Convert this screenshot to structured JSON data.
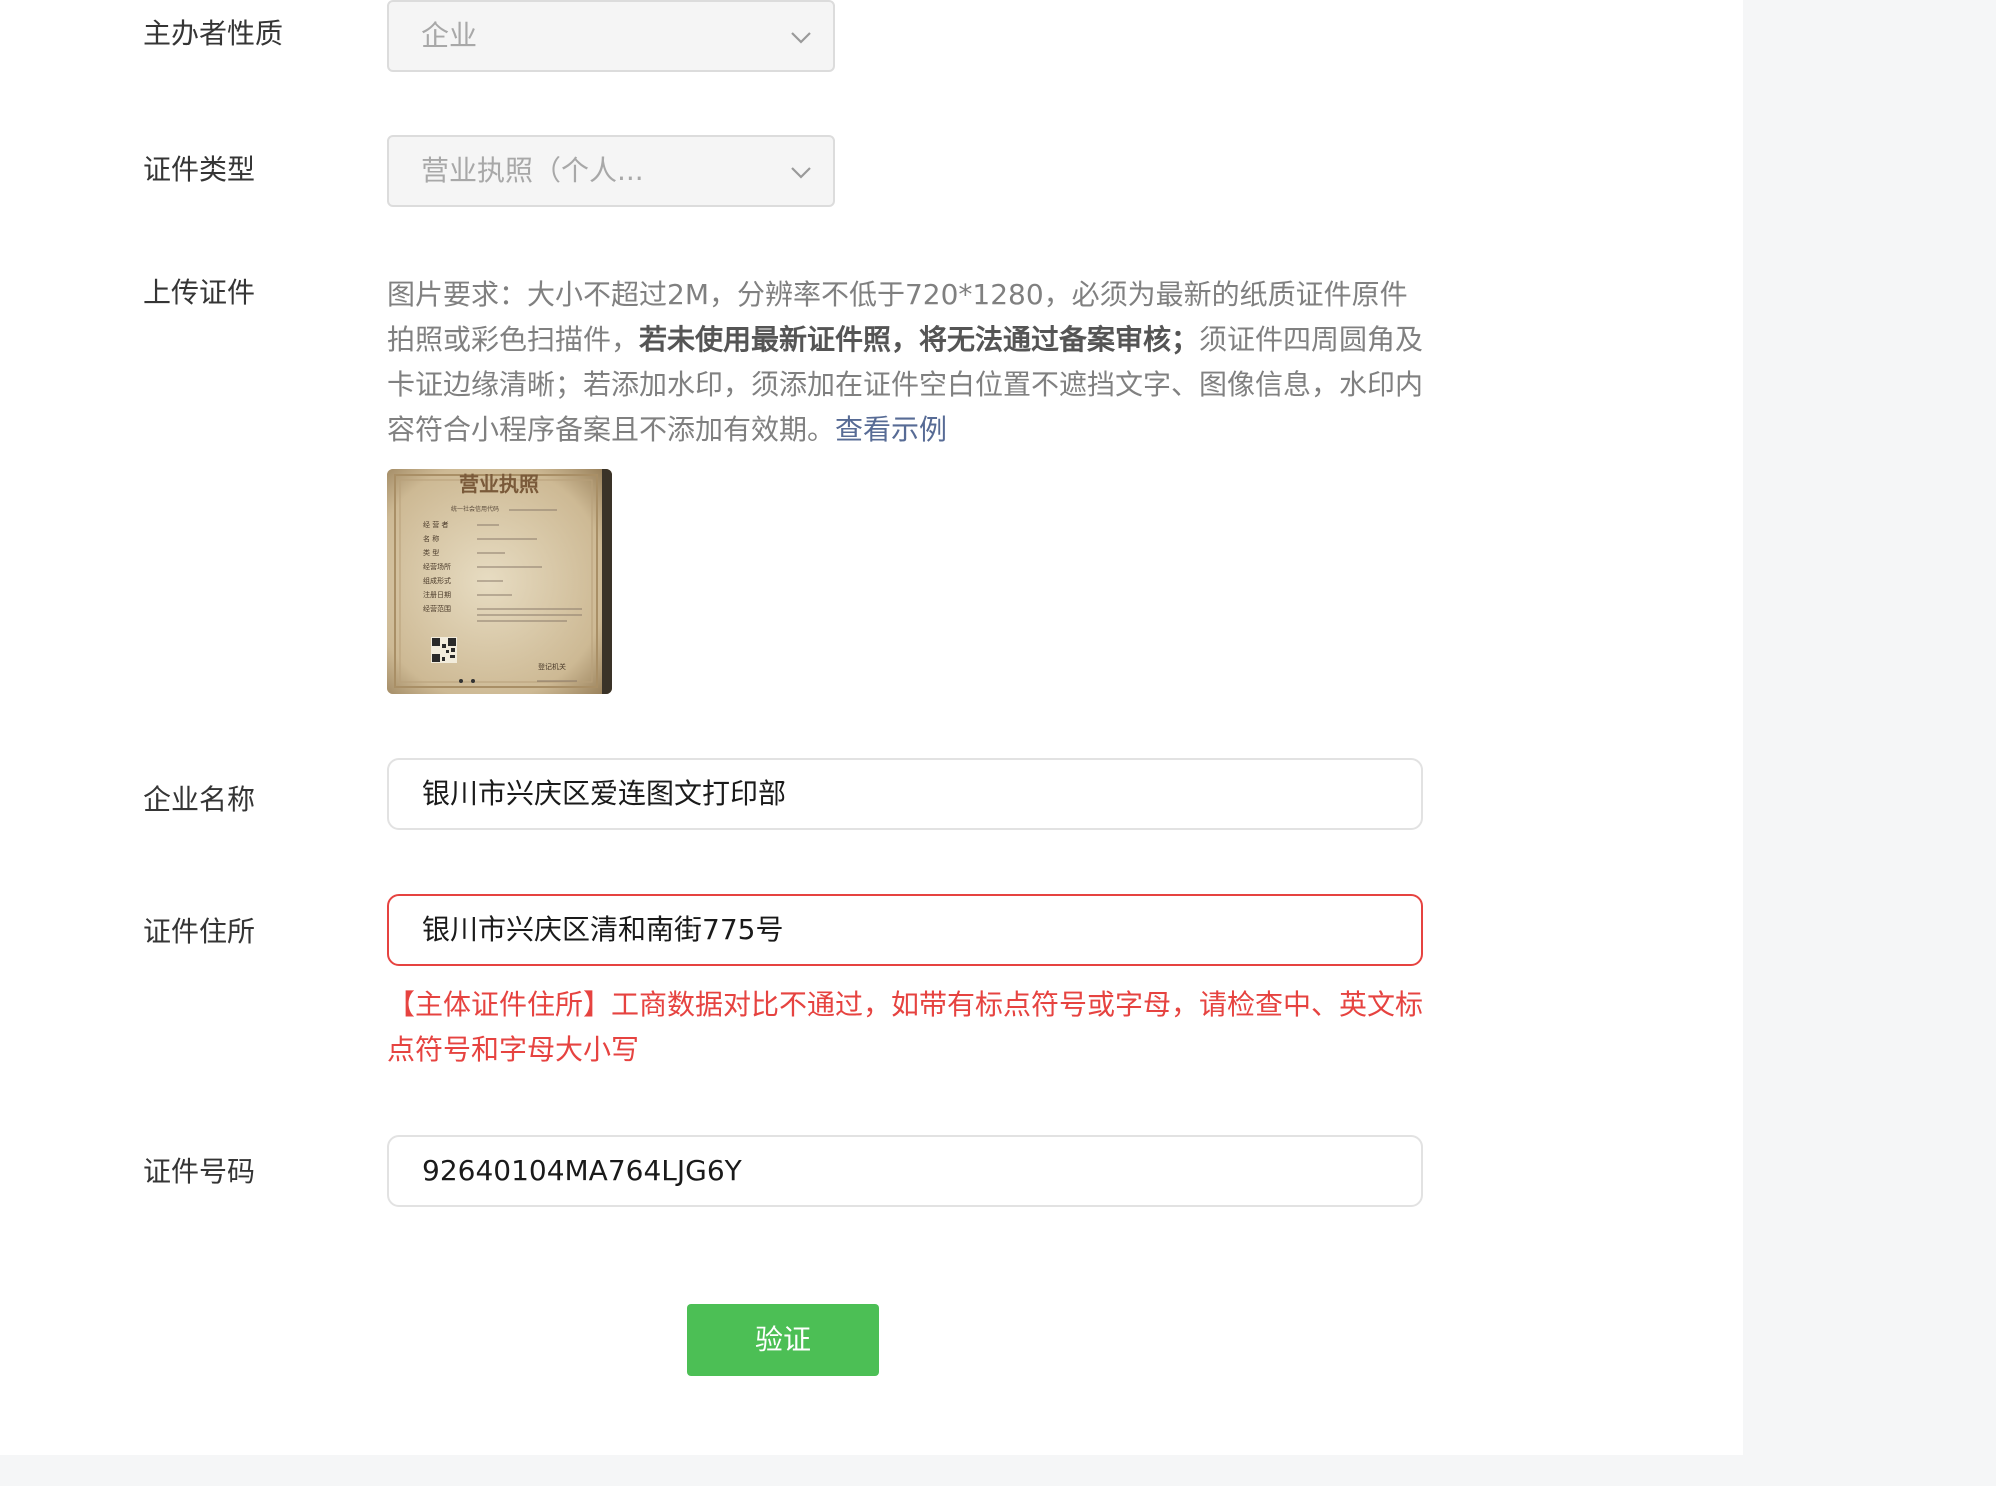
{
  "form": {
    "sponsor_type": {
      "label": "主办者性质",
      "value": "企业"
    },
    "cert_type": {
      "label": "证件类型",
      "value": "营业执照（个人..."
    },
    "upload": {
      "label": "上传证件",
      "req_part1": "图片要求：大小不超过2M，分辨率不低于720*1280，必须为最新的纸质证件原件拍照或彩色扫描件，",
      "req_bold": "若未使用最新证件照，将无法通过备案审核；",
      "req_part2": "须证件四周圆角及卡证边缘清晰；若添加水印，须添加在证件空白位置不遮挡文字、图像信息，水印内容符合小程序备案且不添加有效期。",
      "example_link": "查看示例",
      "thumbnail": {
        "title": "营业执照",
        "subtitle": "统一社会信用代码",
        "fields": [
          "经 营 者",
          "名 称",
          "类 型",
          "经营场所",
          "组成形式",
          "注册日期",
          "经营范围"
        ],
        "issuer": "登记机关"
      }
    },
    "company_name": {
      "label": "企业名称",
      "value": "银川市兴庆区爱连图文打印部"
    },
    "cert_address": {
      "label": "证件住所",
      "value": "银川市兴庆区清和南街775号",
      "error": "【主体证件住所】工商数据对比不通过，如带有标点符号或字母，请检查中、英文标点符号和字母大小写"
    },
    "cert_number": {
      "label": "证件号码",
      "value": "92640104MA764LJG6Y"
    },
    "verify_button": "验证"
  },
  "colors": {
    "primary_green": "#4cbf55",
    "error_red": "#e64340",
    "link_blue": "#576b95"
  }
}
